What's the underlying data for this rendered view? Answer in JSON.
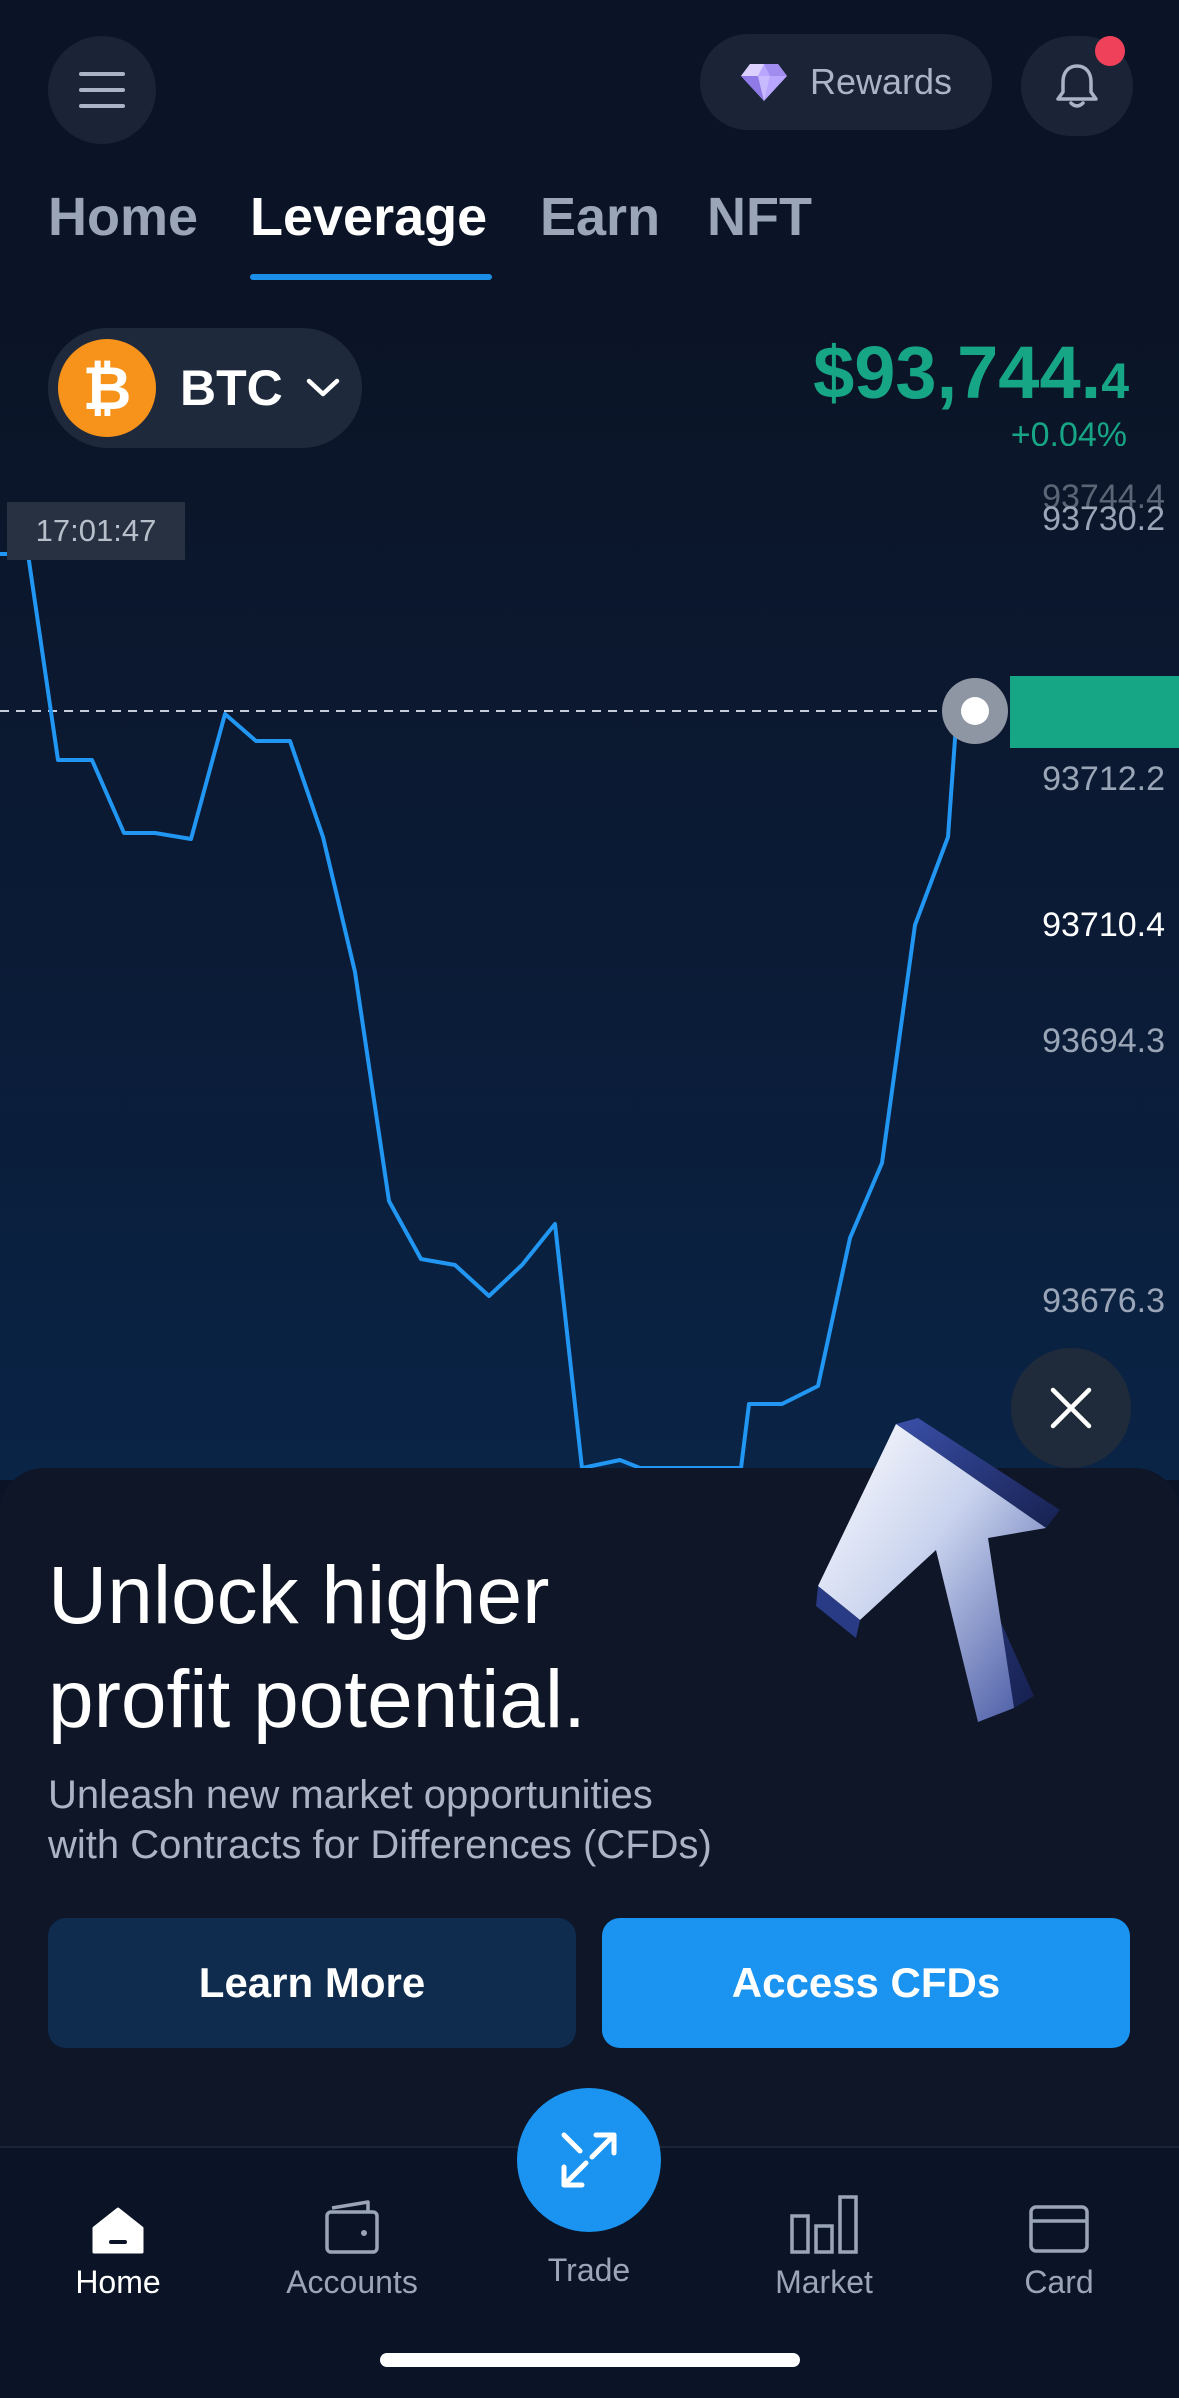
{
  "header": {
    "rewards_label": "Rewards"
  },
  "tabs": [
    {
      "label": "Home"
    },
    {
      "label": "Leverage"
    },
    {
      "label": "Earn"
    },
    {
      "label": "NFT"
    }
  ],
  "coin": {
    "symbol": "BTC",
    "price_main": "$93,744.",
    "price_decimal": "4",
    "change": "+0.04%"
  },
  "chart": {
    "time_label": "17:01:47",
    "price_labels": [
      "93744.4",
      "93730.2",
      "93712.2",
      "93710.4",
      "93694.3",
      "93676.3"
    ]
  },
  "promo": {
    "title_line1": "Unlock higher",
    "title_line2": "profit potential.",
    "desc_line1": "Unleash new market opportunities",
    "desc_line2": "with Contracts for Differences (CFDs)",
    "learn_more": "Learn More",
    "access_cfds": "Access CFDs"
  },
  "nav": {
    "home": "Home",
    "accounts": "Accounts",
    "trade": "Trade",
    "market": "Market",
    "card": "Card"
  },
  "colors": {
    "accent": "#1a94f0",
    "positive": "#16a685",
    "background": "#0b1426",
    "notification": "#f0415b"
  }
}
